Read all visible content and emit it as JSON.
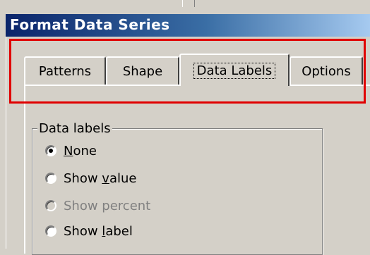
{
  "dialog": {
    "title": "Format Data Series"
  },
  "tabs": [
    {
      "label": "Patterns"
    },
    {
      "label": "Shape"
    },
    {
      "label": "Data Labels",
      "selected": true
    },
    {
      "label": "Options"
    }
  ],
  "data_labels_group": {
    "title": "Data labels",
    "options": [
      {
        "pre": "",
        "key": "N",
        "post": "one",
        "checked": true,
        "enabled": true
      },
      {
        "pre": "Show ",
        "key": "v",
        "post": "alue",
        "checked": false,
        "enabled": true
      },
      {
        "pre": "Show percent",
        "key": "",
        "post": "",
        "checked": false,
        "enabled": false
      },
      {
        "pre": "Show ",
        "key": "l",
        "post": "abel",
        "checked": false,
        "enabled": true
      }
    ]
  },
  "colors": {
    "highlight": "#e00000",
    "title_bar_start": "#0a246a",
    "dialog_face": "#d4d0c8"
  }
}
